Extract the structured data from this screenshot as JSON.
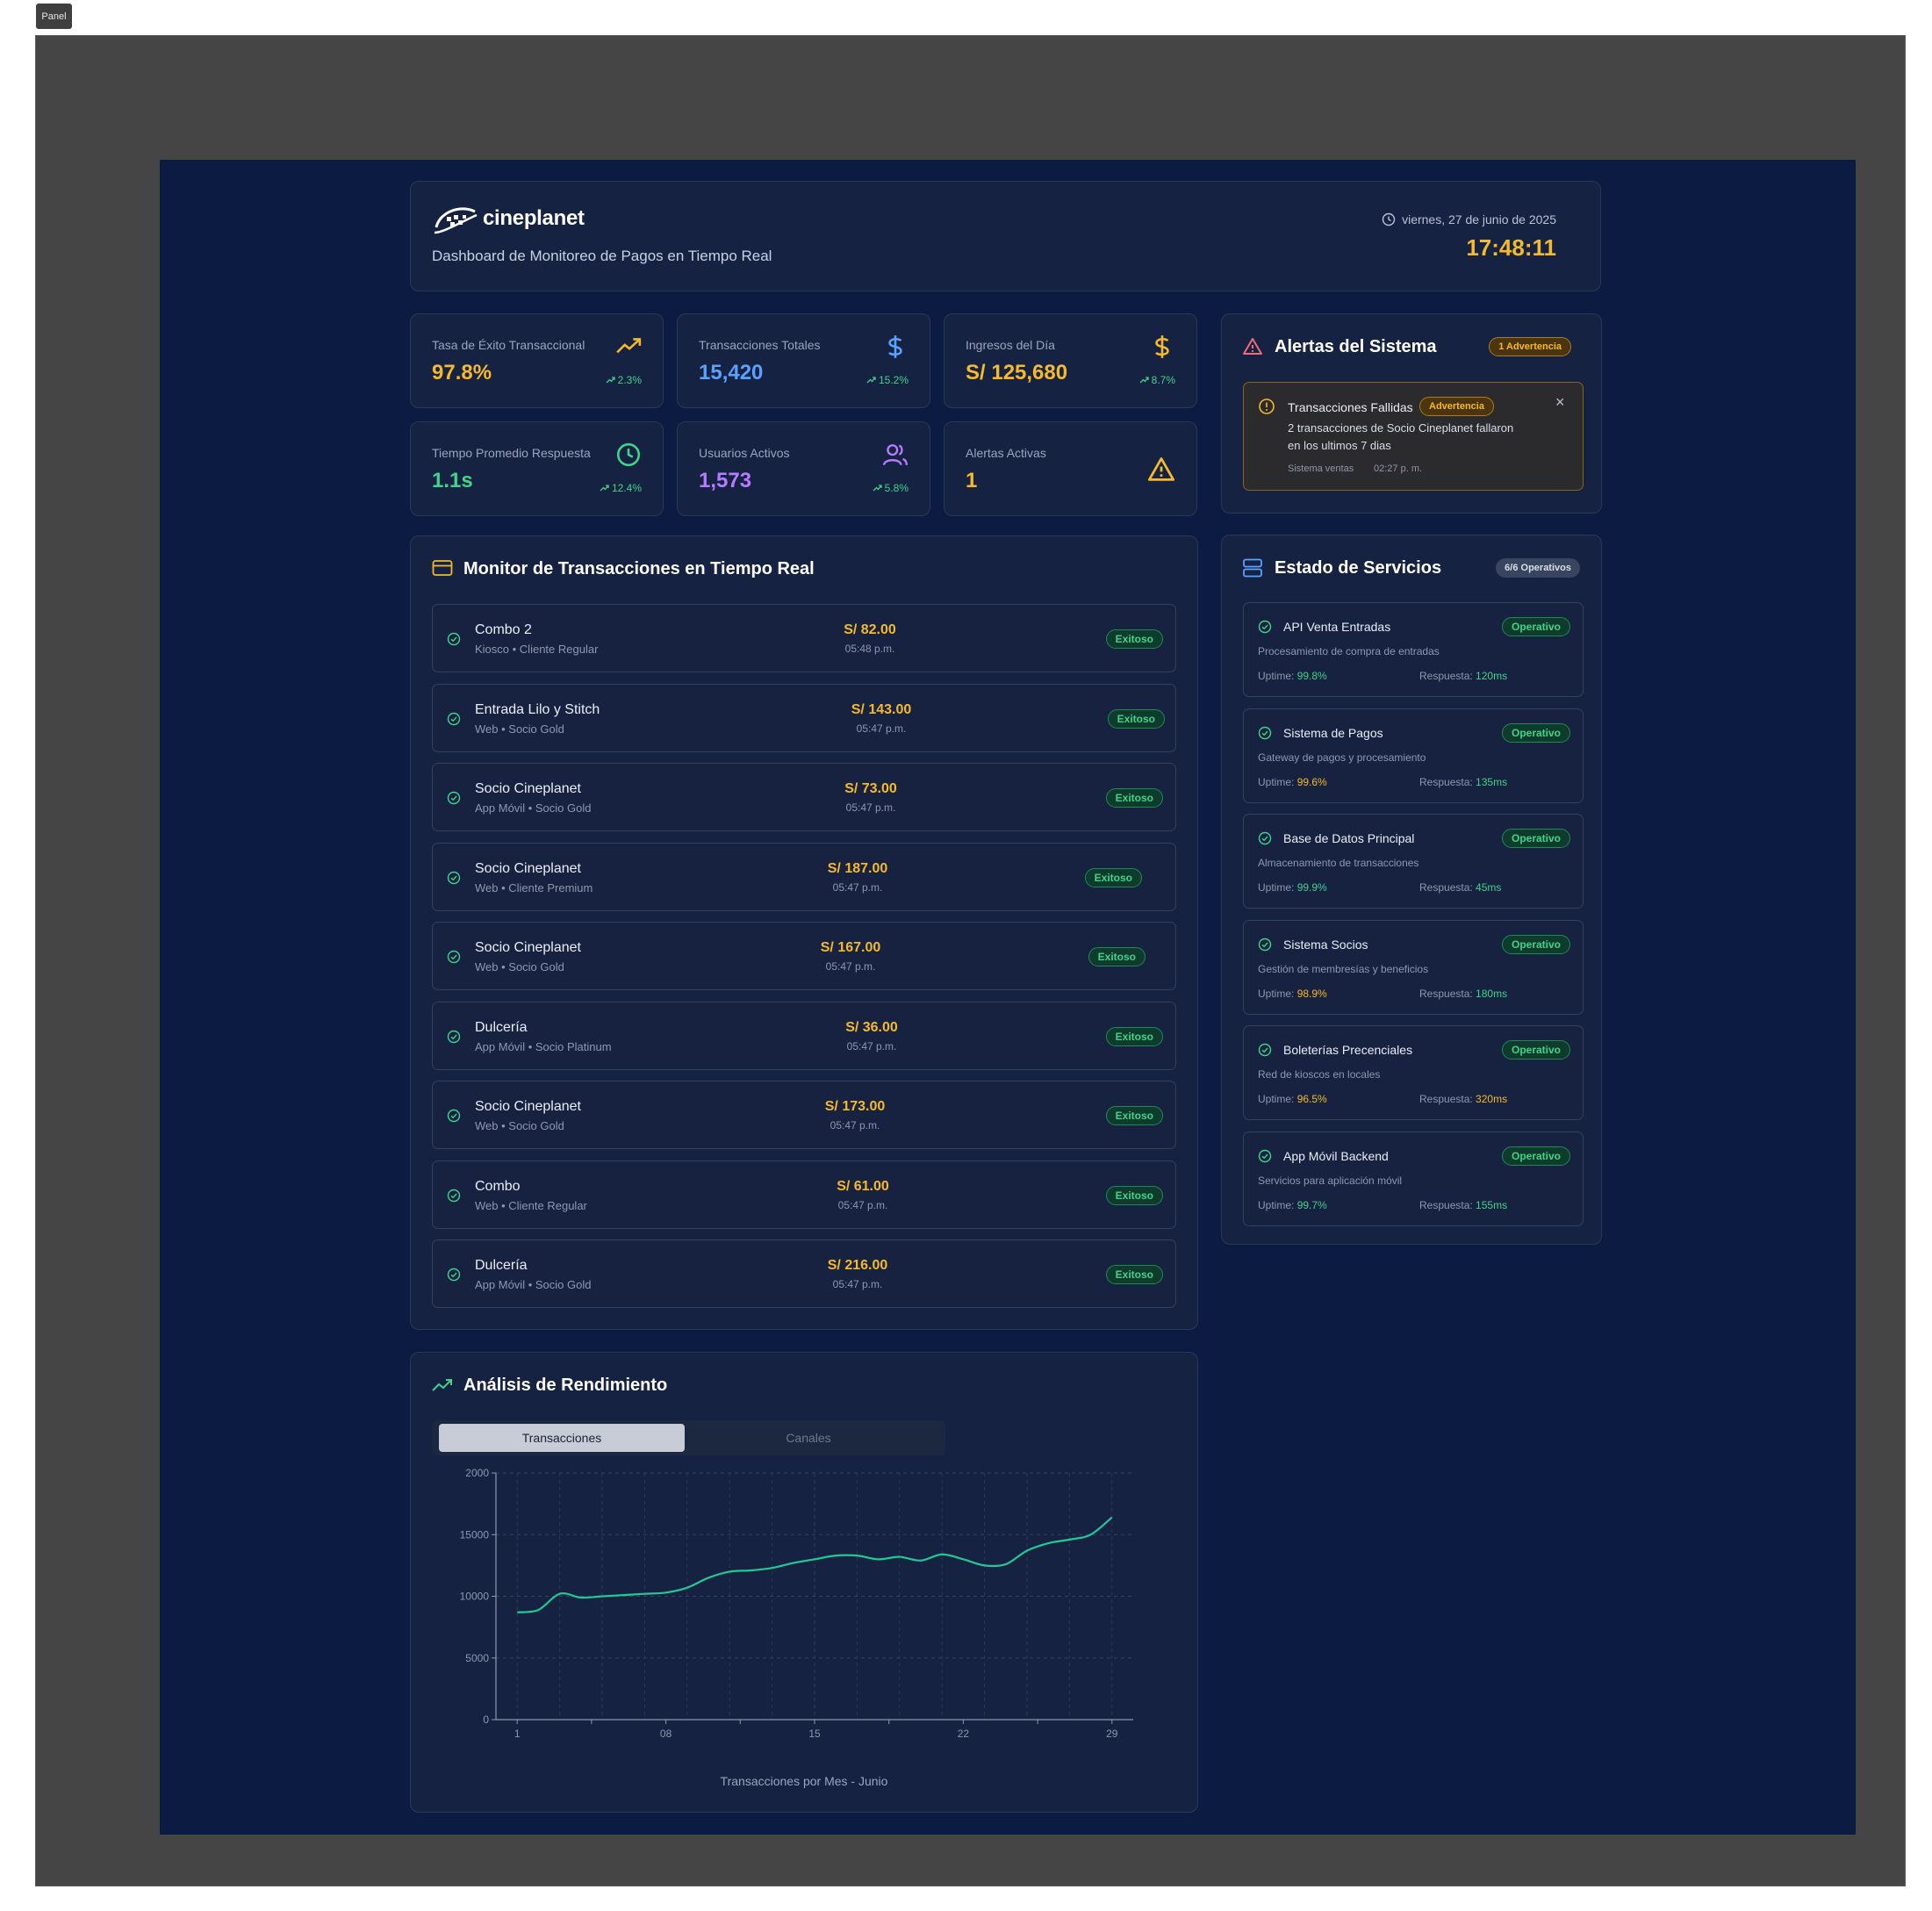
{
  "panel_label": "Panel",
  "header": {
    "brand": "cineplanet",
    "subtitle": "Dashboard de Monitoreo de Pagos en Tiempo Real",
    "date": "viernes, 27 de junio de 2025",
    "time": "17:48:11"
  },
  "stats": [
    {
      "label": "Tasa de Éxito Transaccional",
      "value": "97.8%",
      "change": "2.3%",
      "icon": "trending-up-icon",
      "color": "#f5b92a"
    },
    {
      "label": "Transacciones Totales",
      "value": "15,420",
      "change": "15.2%",
      "icon": "dollar-icon",
      "color": "#5aa2ff"
    },
    {
      "label": "Ingresos del Día",
      "value": "S/ 125,680",
      "change": "8.7%",
      "icon": "dollar-icon",
      "color": "#f5b92a"
    },
    {
      "label": "Tiempo Promedio Respuesta",
      "value": "1.1s",
      "change": "12.4%",
      "icon": "clock-icon",
      "color": "#3fd48a"
    },
    {
      "label": "Usuarios Activos",
      "value": "1,573",
      "change": "5.8%",
      "icon": "users-icon",
      "color": "#b57cff"
    },
    {
      "label": "Alertas Activas",
      "value": "1",
      "change": "",
      "icon": "warning-icon",
      "color": "#f5b92a"
    }
  ],
  "alerts": {
    "title": "Alertas del Sistema",
    "badge": "1 Advertencia",
    "item": {
      "title": "Transacciones Fallidas",
      "tag": "Advertencia",
      "message_line1": "2 transacciones de Socio Cineplanet fallaron",
      "message_line2": "en los ultimos 7 dias",
      "source": "Sistema ventas",
      "time": "02:27 p. m."
    }
  },
  "monitor": {
    "title": "Monitor de Transacciones en Tiempo Real",
    "transactions": [
      {
        "name": "Combo 2",
        "meta": "Kiosco • Cliente Regular",
        "amount": "S/ 82.00",
        "time": "05:48 p.m.",
        "status": "Exitoso"
      },
      {
        "name": "Entrada Lilo y Stitch",
        "meta": "Web • Socio Gold",
        "amount": "S/ 143.00",
        "time": "05:47 p.m.",
        "status": "Exitoso"
      },
      {
        "name": "Socio Cineplanet",
        "meta": "App Móvil • Socio Gold",
        "amount": "S/ 73.00",
        "time": "05:47 p.m.",
        "status": "Exitoso"
      },
      {
        "name": "Socio Cineplanet",
        "meta": "Web • Cliente Premium",
        "amount": "S/ 187.00",
        "time": "05:47 p.m.",
        "status": "Exitoso"
      },
      {
        "name": "Socio Cineplanet",
        "meta": "Web • Socio Gold",
        "amount": "S/ 167.00",
        "time": "05:47 p.m.",
        "status": "Exitoso"
      },
      {
        "name": "Dulcería",
        "meta": "App Móvil • Socio Platinum",
        "amount": "S/ 36.00",
        "time": "05:47 p.m.",
        "status": "Exitoso"
      },
      {
        "name": "Socio Cineplanet",
        "meta": "Web • Socio Gold",
        "amount": "S/ 173.00",
        "time": "05:47 p.m.",
        "status": "Exitoso"
      },
      {
        "name": "Combo",
        "meta": "Web • Cliente Regular",
        "amount": "S/ 61.00",
        "time": "05:47 p.m.",
        "status": "Exitoso"
      },
      {
        "name": "Dulcería",
        "meta": "App Móvil • Socio Gold",
        "amount": "S/ 216.00",
        "time": "05:47 p.m.",
        "status": "Exitoso"
      }
    ]
  },
  "services": {
    "title": "Estado de Servicios",
    "badge": "6/6 Operativos",
    "uptime_label": "Uptime:",
    "response_label": "Respuesta:",
    "items": [
      {
        "name": "API Venta Entradas",
        "desc": "Procesamiento de compra de entradas",
        "uptime": "99.8%",
        "response": "120ms",
        "status": "Operativo",
        "uptime_color": "#3fd48a",
        "response_color": "#3fd48a"
      },
      {
        "name": "Sistema de Pagos",
        "desc": "Gateway de pagos y procesamiento",
        "uptime": "99.6%",
        "response": "135ms",
        "status": "Operativo",
        "uptime_color": "#f5b92a",
        "response_color": "#3fd48a"
      },
      {
        "name": "Base de Datos Principal",
        "desc": "Almacenamiento de transacciones",
        "uptime": "99.9%",
        "response": "45ms",
        "status": "Operativo",
        "uptime_color": "#3fd48a",
        "response_color": "#3fd48a"
      },
      {
        "name": "Sistema Socios",
        "desc": "Gestión de membresías y beneficios",
        "uptime": "98.9%",
        "response": "180ms",
        "status": "Operativo",
        "uptime_color": "#f5b92a",
        "response_color": "#3fd48a"
      },
      {
        "name": "Boleterías Precenciales",
        "desc": "Red de kioscos en locales",
        "uptime": "96.5%",
        "response": "320ms",
        "status": "Operativo",
        "uptime_color": "#f5b92a",
        "response_color": "#f5b92a"
      },
      {
        "name": "App Móvil Backend",
        "desc": "Servicios para aplicación móvil",
        "uptime": "99.7%",
        "response": "155ms",
        "status": "Operativo",
        "uptime_color": "#3fd48a",
        "response_color": "#3fd48a"
      }
    ]
  },
  "performance": {
    "title": "Análisis de Rendimiento",
    "tabs": [
      "Transacciones",
      "Canales"
    ],
    "active_tab": "Transacciones"
  },
  "chart_data": {
    "type": "line",
    "title": "",
    "xlabel": "Transacciones por Mes -  Junio",
    "ylabel": "",
    "ylim": [
      0,
      20000
    ],
    "y_tick_labels": [
      "0",
      "5000",
      "10000",
      "15000",
      "2000"
    ],
    "y_tick_values": [
      0,
      5000,
      10000,
      15000,
      20000
    ],
    "x_tick_labels": [
      "1",
      "08",
      "15",
      "22",
      "29"
    ],
    "x_tick_values": [
      1,
      8,
      15,
      22,
      29
    ],
    "grid": true,
    "color": "#20c997",
    "series": [
      {
        "x": [
          1,
          2,
          3,
          4,
          5,
          6,
          7,
          8,
          9,
          10,
          11,
          12,
          13,
          14,
          15,
          16,
          17,
          18,
          19,
          20,
          21,
          22,
          23,
          24,
          25,
          26,
          27,
          28,
          29
        ],
        "values": [
          8700,
          8900,
          10200,
          9900,
          10000,
          10100,
          10200,
          10300,
          10700,
          11500,
          12000,
          12100,
          12300,
          12700,
          13000,
          13300,
          13300,
          13000,
          13200,
          12900,
          13400,
          13000,
          12500,
          12600,
          13700,
          14300,
          14600,
          15000,
          16400
        ]
      }
    ]
  },
  "colors": {
    "background": "#0c1b42",
    "card": "#162241",
    "accent_yellow": "#f5b92a",
    "success": "#3fd48a",
    "line": "#20c997"
  }
}
